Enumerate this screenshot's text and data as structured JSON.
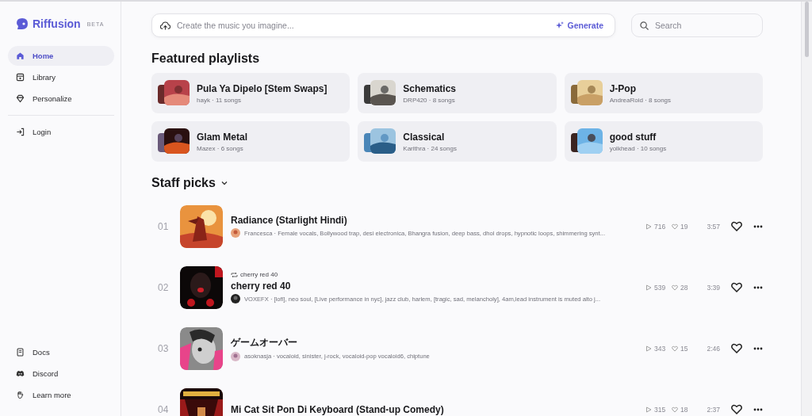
{
  "sidebar": {
    "brand": {
      "name": "Riffusion",
      "badge": "BETA"
    },
    "nav": [
      {
        "label": "Home",
        "selected": true
      },
      {
        "label": "Library",
        "selected": false
      },
      {
        "label": "Personalize",
        "selected": false
      }
    ],
    "account": [
      {
        "label": "Login"
      }
    ],
    "footer": [
      {
        "label": "Docs"
      },
      {
        "label": "Discord"
      },
      {
        "label": "Learn more"
      }
    ]
  },
  "prompt": {
    "placeholder": "Create the music you imagine...",
    "button": "Generate"
  },
  "search": {
    "placeholder": "Search"
  },
  "featured": {
    "title": "Featured playlists",
    "playlists": [
      {
        "name": "Pula Ya Dipelo [Stem Swaps]",
        "meta": "hayk · 11 songs"
      },
      {
        "name": "Schematics",
        "meta": "DRP420 · 8 songs"
      },
      {
        "name": "J-Pop",
        "meta": "AndreaRoid · 8 songs"
      },
      {
        "name": "Glam Metal",
        "meta": "Mazex · 6 songs"
      },
      {
        "name": "Classical",
        "meta": "Karithra · 24 songs"
      },
      {
        "name": "good stuff",
        "meta": "yolkhead · 10 songs"
      }
    ]
  },
  "staff_picks": {
    "title": "Staff picks",
    "tracks": [
      {
        "number": "01",
        "title": "Radiance (Starlight Hindi)",
        "meta": "Francesca · Female vocals, Bollywood trap, desi electronica, Bhangra fusion, deep bass, dhol drops, hypnotic loops, shimmering synt...",
        "plays": "716",
        "likes": "19",
        "duration": "3:57",
        "liked": false
      },
      {
        "number": "02",
        "remix_of": "cherry red 40",
        "title": "cherry red 40",
        "meta": "VOXEFX · [lofi], neo soul, [Live performance in nyc], jazz club, harlem, [tragic, sad, melancholy], 4am,lead instrument is muted alto j...",
        "plays": "539",
        "likes": "28",
        "duration": "3:39",
        "liked": false
      },
      {
        "number": "03",
        "title": "ゲームオーバー",
        "meta": "asoknasja · vocaloid, sinister, j-rock, vocaloid-pop vocaloid6, chiptune",
        "plays": "343",
        "likes": "15",
        "duration": "2:46",
        "liked": false
      },
      {
        "number": "04",
        "title": "Mi Cat Sit Pon Di Keyboard (Stand-up Comedy)",
        "plays": "315",
        "likes": "18",
        "duration": "2:37",
        "liked": false
      }
    ]
  }
}
